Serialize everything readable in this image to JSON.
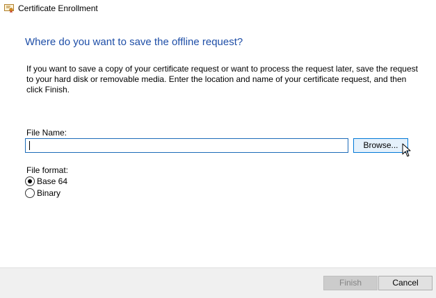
{
  "window": {
    "title": "Certificate Enrollment",
    "title_icon": "certificate-icon"
  },
  "main": {
    "heading": "Where do you want to save the offline request?",
    "description": "If you want to save a copy of your certificate request or want to process the request later, save the request to your hard disk or removable media. Enter the location and name of your certificate request, and then click Finish.",
    "file_name_label": "File Name:",
    "file_name_value": "",
    "browse_label": "Browse...",
    "file_format_label": "File format:",
    "formats": [
      {
        "label": "Base 64",
        "checked": true
      },
      {
        "label": "Binary",
        "checked": false
      }
    ]
  },
  "footer": {
    "finish_label": "Finish",
    "finish_enabled": false,
    "cancel_label": "Cancel"
  },
  "colors": {
    "heading": "#1e4ea7",
    "input_border": "#1b6bb8",
    "browse_hover_bg": "#e5f1fb",
    "browse_hover_border": "#0078d7"
  }
}
